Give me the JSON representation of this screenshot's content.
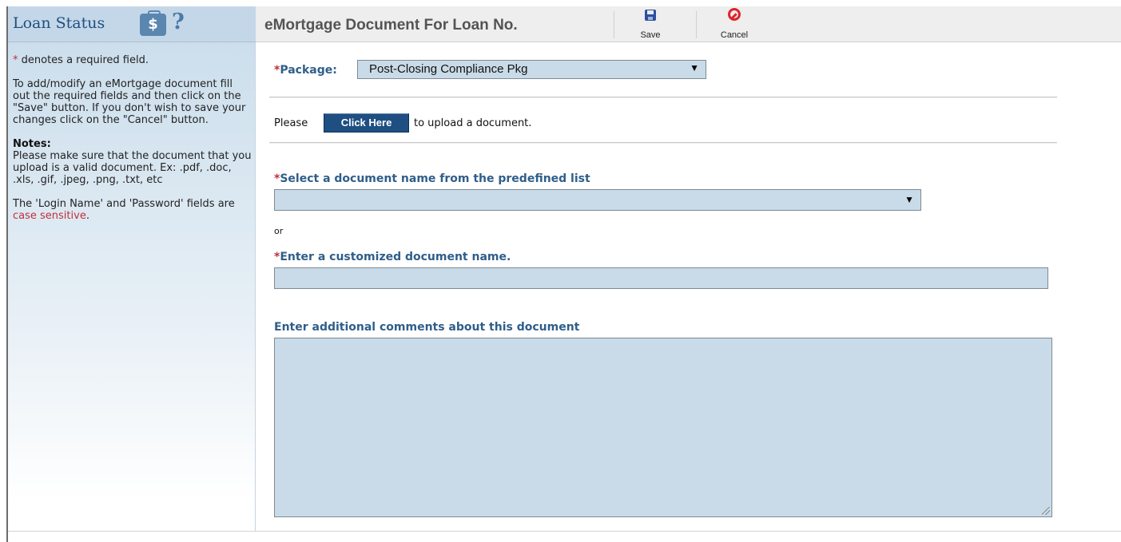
{
  "sidebar": {
    "title": "Loan Status",
    "briefcase_icon": "$",
    "help_icon": "?",
    "required_marker": "*",
    "required_note": " denotes a required field.",
    "instructions": "To add/modify an eMortgage document fill out the required fields and then click on the \"Save\" button. If you don't wish to save your changes click on the \"Cancel\" button.",
    "notes_heading": "Notes:",
    "notes_text": "Please make sure that the document that you upload is a valid document. Ex: .pdf, .doc, .xls, .gif, .jpeg, .png, .txt, etc",
    "case_note_prefix": "The 'Login Name' and 'Password' fields are ",
    "case_note_emphasis": "case sensitive",
    "case_note_suffix": "."
  },
  "header": {
    "title": "eMortgage Document For Loan No.",
    "save_label": "Save",
    "cancel_label": "Cancel"
  },
  "form": {
    "required_marker": "*",
    "package_label": "Package:",
    "package_value": "Post-Closing Compliance Pkg",
    "upload_prefix": "Please",
    "upload_button": "Click Here",
    "upload_suffix": "to upload a document.",
    "doc_select_label": "Select a document name from the predefined list",
    "doc_select_value": "",
    "or_text": "or",
    "custom_name_label": "Enter a customized document name.",
    "custom_name_value": "",
    "comments_label": "Enter additional comments about this document",
    "comments_value": "",
    "dropdown_arrow": "▼"
  },
  "colors": {
    "label_blue": "#2f5e8a",
    "required_red": "#c0303a",
    "field_bg": "#c9dbe8",
    "button_navy": "#1f4f82"
  }
}
